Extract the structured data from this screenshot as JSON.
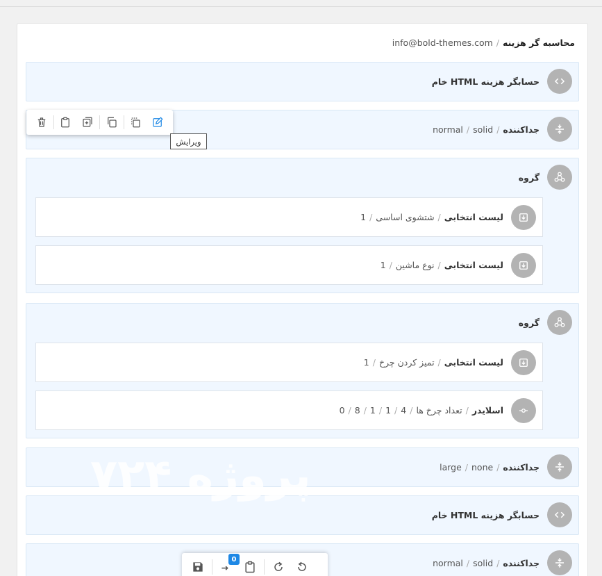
{
  "breadcrumb": {
    "title": "محاسبه گر هزینه",
    "email": "info@bold-themes.com"
  },
  "blocks": [
    {
      "title": "حسابگر هزینه HTML خام"
    },
    {
      "title": "جداکننده",
      "p1": "solid",
      "p2": "normal"
    },
    {
      "title": "گروه",
      "items": [
        {
          "title": "لیست انتخابی",
          "p1": "شتشوی اساسی",
          "p2": "1"
        },
        {
          "title": "لیست انتخابی",
          "p1": "نوع ماشین",
          "p2": "1"
        }
      ]
    },
    {
      "title": "گروه",
      "items": [
        {
          "title": "لیست انتخابی",
          "p1": "تمیز کردن چرخ",
          "p2": "1"
        },
        {
          "title": "اسلایدر",
          "p1": "تعداد چرخ ها",
          "vals": [
            "0",
            "8",
            "1",
            "1",
            "4"
          ]
        }
      ]
    },
    {
      "title": "جداکننده",
      "p1": "none",
      "p2": "large"
    },
    {
      "title": "حسابگر هزینه HTML خام"
    },
    {
      "title": "جداکننده",
      "p1": "solid",
      "p2": "normal"
    }
  ],
  "tooltip": "ویرایش",
  "watermark": "پروژه ۷۲۴",
  "bottombar": {
    "badge": "0"
  },
  "colors": {
    "accent": "#1e88e5",
    "block_bg": "#f0f7ff",
    "icon_bg": "#b3b3b3"
  }
}
